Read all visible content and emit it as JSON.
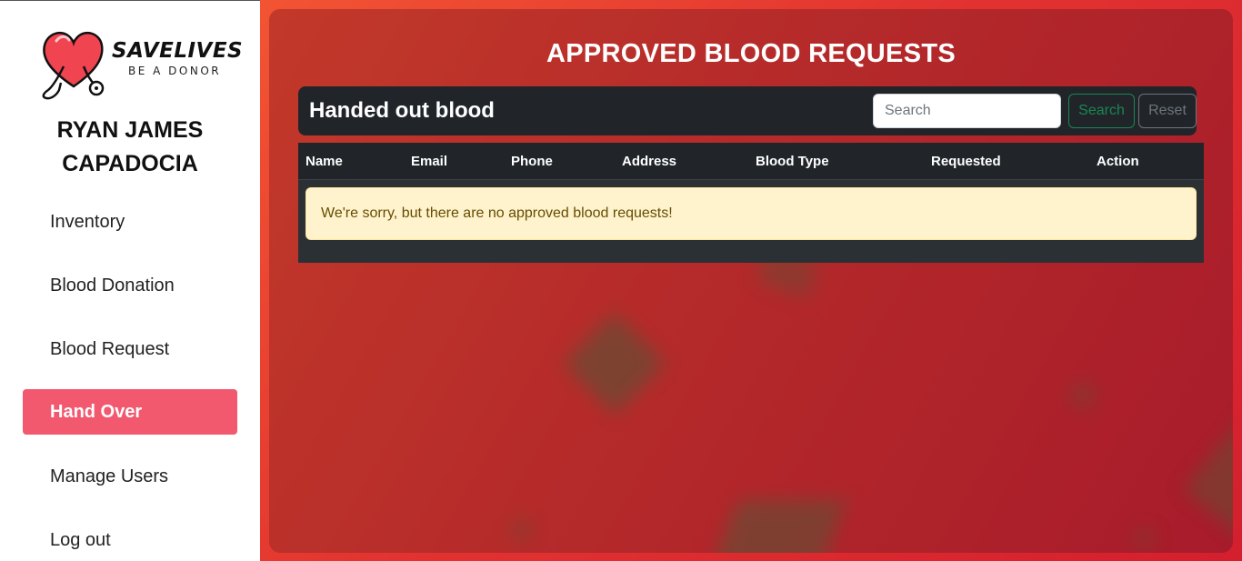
{
  "brand": {
    "name": "SAVELIVES",
    "tagline": "BE A DONOR"
  },
  "user": {
    "name": "RYAN JAMES CAPADOCIA"
  },
  "sidebar": {
    "items": [
      {
        "label": "Inventory",
        "active": false
      },
      {
        "label": "Blood Donation",
        "active": false
      },
      {
        "label": "Blood Request",
        "active": false
      },
      {
        "label": "Hand Over",
        "active": true
      },
      {
        "label": "Manage Users",
        "active": false
      },
      {
        "label": "Log out",
        "active": false
      }
    ]
  },
  "page": {
    "title": "APPROVED BLOOD REQUESTS"
  },
  "toolbar": {
    "title": "Handed out blood",
    "search_placeholder": "Search",
    "search_value": "",
    "search_label": "Search",
    "reset_label": "Reset"
  },
  "table": {
    "columns": [
      "Name",
      "Email",
      "Phone",
      "Address",
      "Blood Type",
      "Requested",
      "Action"
    ],
    "rows": [],
    "empty_message": "We're sorry, but there are no approved blood requests!"
  },
  "colors": {
    "accent": "#f2596f",
    "background_start": "#f25433",
    "background_end": "#d41f2e",
    "table_dark": "#212529",
    "alert_bg": "#fff3cd"
  },
  "icons": {
    "logo": "heart-stethoscope-icon"
  }
}
